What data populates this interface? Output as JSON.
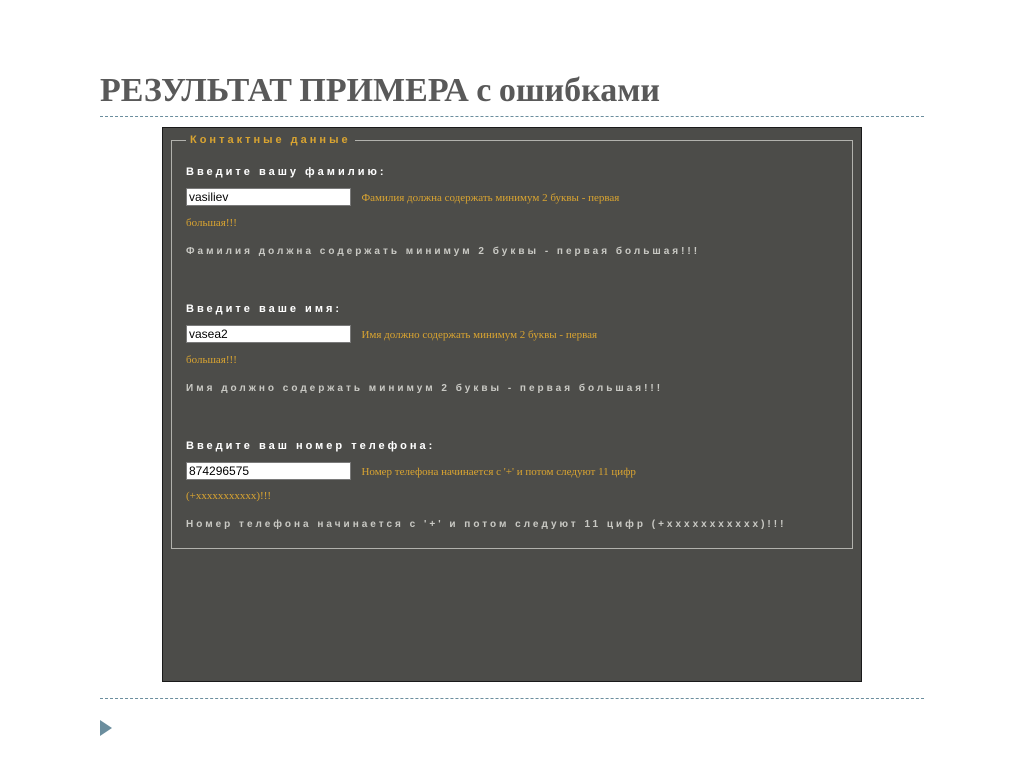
{
  "slide": {
    "title": "РЕЗУЛЬТАТ ПРИМЕРА с ошибками"
  },
  "form": {
    "legend": "Контактные данные",
    "surname": {
      "label": "Введите вашу фамилию:",
      "value": "vasiliev",
      "inline_error": "Фамилия должна содержать минимум 2 буквы - первая",
      "inline_error_cont": "большая!!!",
      "static_hint": "Фамилия должна содержать минимум 2 буквы - первая большая!!!"
    },
    "name": {
      "label": "Введите ваше имя:",
      "value": "vasea2",
      "inline_error": "Имя должно содержать минимум 2 буквы - первая",
      "inline_error_cont": "большая!!!",
      "static_hint": "Имя должно содержать минимум 2 буквы - первая большая!!!"
    },
    "phone": {
      "label": "Введите ваш номер телефона:",
      "value": "874296575",
      "inline_error": "Номер телефона начинается с '+' и потом следуют 11 цифр",
      "inline_error_cont": "(+xxxxxxxxxxx)!!!",
      "static_hint": "Номер телефона начинается с '+' и потом следуют 11 цифр (+xxxxxxxxxxx)!!!"
    }
  }
}
